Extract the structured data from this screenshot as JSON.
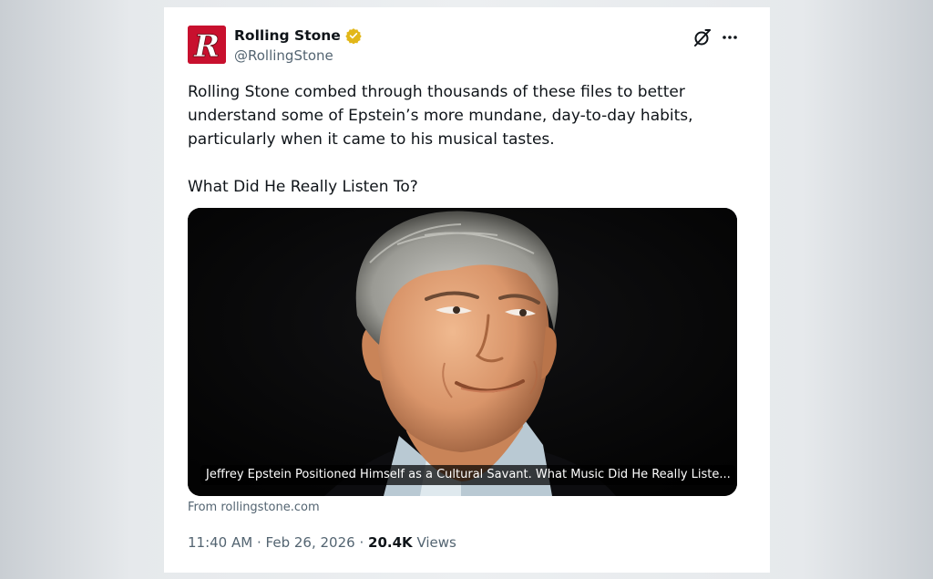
{
  "tweet": {
    "author": {
      "display_name": "Rolling Stone",
      "handle": "@RollingStone",
      "logo_letter": "R",
      "verified_icon": "gold-verified-badge",
      "brand_color": "#c8102e"
    },
    "actions": {
      "grok_icon": "grok-icon",
      "more_icon": "more-horizontal-icon"
    },
    "text": {
      "paragraph_1": "Rolling Stone combed through thousands of these files to better understand some of Epstein’s more mundane, day-to-day habits, particularly when it came to his musical tastes.",
      "paragraph_2": "What Did He Really Listen To?"
    },
    "link_card": {
      "image_alt": "Photo of a smiling grey-haired man against a dark background",
      "caption": "Jeffrey Epstein Positioned Himself as a Cultural Savant. What Music Did He Really Liste...",
      "source": "From rollingstone.com"
    },
    "meta": {
      "time": "11:40 AM",
      "separator": "·",
      "date": "Feb 26, 2026",
      "views_count": "20.4K",
      "views_label": "Views"
    }
  }
}
